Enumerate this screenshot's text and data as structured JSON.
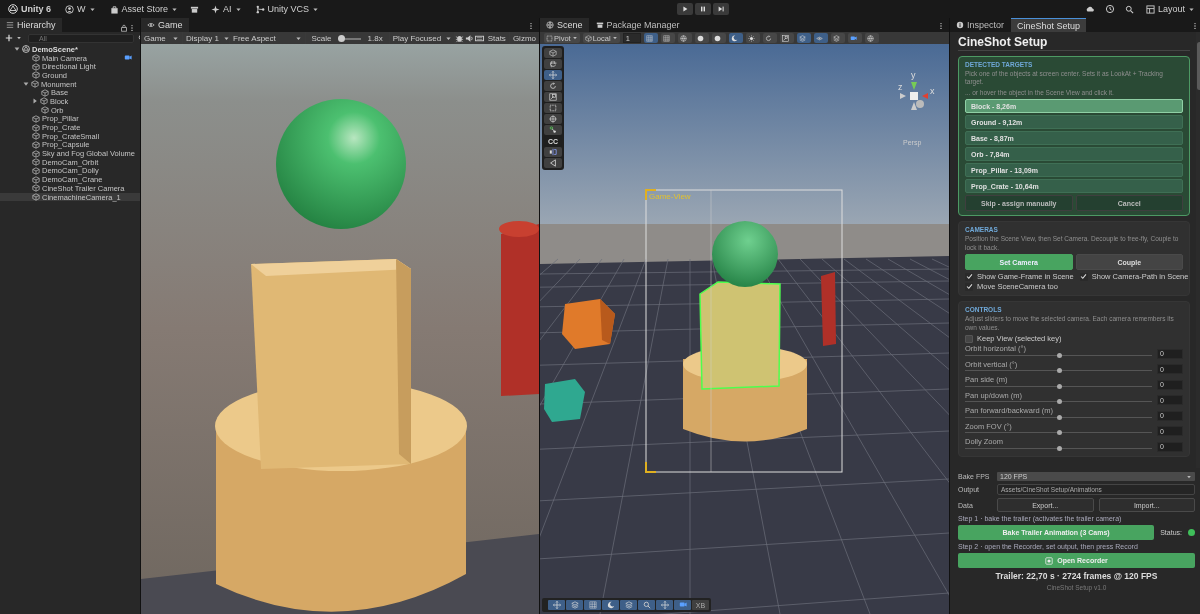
{
  "toolbar": {
    "product": "Unity 6",
    "account": "W",
    "asset_store": "Asset Store",
    "ai": "AI",
    "vcs": "Unity VCS",
    "layout": "Layout"
  },
  "hierarchy": {
    "tab": "Hierarchy",
    "search": {
      "placeholder": "All"
    },
    "tree": [
      {
        "label": "DemoScene*",
        "kind": "scene",
        "expanded": true,
        "selected": false,
        "children": [
          {
            "label": "Main Camera",
            "kind": "object",
            "selected": false,
            "badge": true
          },
          {
            "label": "Directional Light",
            "kind": "object",
            "selected": false
          },
          {
            "label": "Ground",
            "kind": "object",
            "selected": false
          },
          {
            "label": "Monument",
            "kind": "object",
            "expanded": true,
            "selected": false,
            "children": [
              {
                "label": "Base",
                "kind": "object",
                "selected": false
              },
              {
                "label": "Block",
                "kind": "object",
                "expanded": false,
                "selected": false
              },
              {
                "label": "Orb",
                "kind": "object",
                "selected": false
              }
            ]
          },
          {
            "label": "Prop_Pillar",
            "kind": "object",
            "selected": false
          },
          {
            "label": "Prop_Crate",
            "kind": "object",
            "selected": false
          },
          {
            "label": "Prop_CrateSmall",
            "kind": "object",
            "selected": false
          },
          {
            "label": "Prop_Capsule",
            "kind": "object",
            "selected": false
          },
          {
            "label": "Sky and Fog Global Volume",
            "kind": "object",
            "selected": false
          },
          {
            "label": "DemoCam_Orbit",
            "kind": "object",
            "selected": false
          },
          {
            "label": "DemoCam_Dolly",
            "kind": "object",
            "selected": false
          },
          {
            "label": "DemoCam_Crane",
            "kind": "object",
            "selected": false
          },
          {
            "label": "CineShot Trailer Camera",
            "kind": "object",
            "selected": false
          },
          {
            "label": "CinemachineCamera_1",
            "kind": "object",
            "selected": true
          }
        ]
      }
    ]
  },
  "game": {
    "tab": "Game",
    "mode": "Game",
    "display": "Display 1",
    "aspect": "Free Aspect",
    "scale_label": "Scale",
    "scale": {
      "level": 0.1
    },
    "scale_value": "1.8x",
    "play_mode": "Play Focused",
    "stats": "Stats",
    "gizmos": "Gizmo"
  },
  "scene": {
    "tabs": [
      {
        "label": "Scene",
        "selected": true
      },
      {
        "label": "Package Manager",
        "selected": false
      }
    ],
    "pivot": "Pivot",
    "space": "Local",
    "grid_value": "1",
    "tools": [
      {
        "kind": "tool",
        "selected": false
      },
      {
        "kind": "tool",
        "selected": false
      },
      {
        "kind": "tool",
        "selected": true
      },
      {
        "kind": "tool",
        "selected": false
      },
      {
        "kind": "tool",
        "selected": false
      },
      {
        "kind": "tool",
        "selected": false
      },
      {
        "kind": "tool",
        "selected": false
      },
      {
        "kind": "tool",
        "selected": false
      },
      {
        "kind": "label",
        "label": "CC",
        "selected": false
      },
      {
        "kind": "tool",
        "selected": false
      },
      {
        "kind": "tool",
        "selected": false
      }
    ],
    "frame_label": "Game-View",
    "axes": {
      "x": "x",
      "y": "y",
      "z": "z"
    },
    "projection": "Persp",
    "bottom_tools": [
      {
        "kind": "tool"
      },
      {
        "kind": "tool"
      },
      {
        "kind": "tool"
      },
      {
        "kind": "tool"
      },
      {
        "kind": "tool"
      },
      {
        "kind": "tool"
      },
      {
        "kind": "tool"
      },
      {
        "kind": "tool"
      },
      {
        "kind": "label",
        "label": "XB"
      }
    ]
  },
  "inspector": {
    "tabs": [
      {
        "label": "Inspector",
        "selected": false
      },
      {
        "label": "CineShot Setup",
        "selected": true
      }
    ],
    "title": "CineShot Setup",
    "targets": {
      "heading": "DETECTED TARGETS",
      "hint": "Pick one of the objects at screen center. Sets it as LookAt + Tracking target.",
      "hint_2": "... or hover the object in the Scene View and click it.",
      "items": [
        {
          "label": "Block  -  8,26m",
          "selected": true
        },
        {
          "label": "Ground  -  9,12m",
          "selected": false
        },
        {
          "label": "Base  -  8,87m",
          "selected": false
        },
        {
          "label": "Orb  -  7,84m",
          "selected": false
        },
        {
          "label": "Prop_Pillar  -  13,09m",
          "selected": false
        },
        {
          "label": "Prop_Crate  -  10,64m",
          "selected": false
        }
      ],
      "skip": "Skip - assign manually",
      "cancel": "Cancel"
    },
    "cameras": {
      "heading": "CAMERAS",
      "hint": "Position the Scene View, then Set Camera. Decouple to free-fly, Couple to lock it back.",
      "set_camera": "Set Camera",
      "couple": "Couple",
      "options": [
        {
          "label": "Show Game-Frame in Scene",
          "checked": true
        },
        {
          "label": "Show Camera-Path in Scene",
          "checked": true
        },
        {
          "label": "Move SceneCamera too",
          "checked": true
        }
      ]
    },
    "controls": {
      "heading": "CONTROLS",
      "hint": "Adjust sliders to move the selected camera. Each camera remembers its own values.",
      "keep_view": {
        "label": "Keep View (selected key)",
        "checked": false
      },
      "sliders": [
        {
          "label": "Orbit horizontal (°)",
          "level": 0.5,
          "value": "0"
        },
        {
          "label": "Orbit vertical (°)",
          "level": 0.5,
          "value": "0"
        },
        {
          "label": "Pan side (m)",
          "level": 0.5,
          "value": "0"
        },
        {
          "label": "Pan up/down (m)",
          "level": 0.5,
          "value": "0"
        },
        {
          "label": "Pan forward/backward (m)",
          "level": 0.5,
          "value": "0"
        },
        {
          "label": "Zoom FOV (°)",
          "level": 0.5,
          "value": "0"
        },
        {
          "label": "Dolly Zoom",
          "level": 0.5,
          "value": "0"
        }
      ]
    },
    "bake_fps": {
      "label": "Bake FPS",
      "value": "120 FPS"
    },
    "output": {
      "label": "Output",
      "value": "Assets/CineShot Setup/Animations"
    },
    "data": {
      "label": "Data",
      "export": "Export...",
      "import": "Import..."
    },
    "step1": {
      "text": "Step 1  ·  bake the trailer (activates the trailer camera)",
      "button": "Bake Trailer Animation (3 Cams)",
      "status_label": "Status:",
      "status_ok": true
    },
    "step2": {
      "text": "Step 2  ·  open the Recorder, set output, then press Record",
      "button": "Open Recorder"
    },
    "summary": "Trailer: 22,70 s  ·  2724 frames @ 120 FPS",
    "version": "CineShot Setup v1.0"
  }
}
